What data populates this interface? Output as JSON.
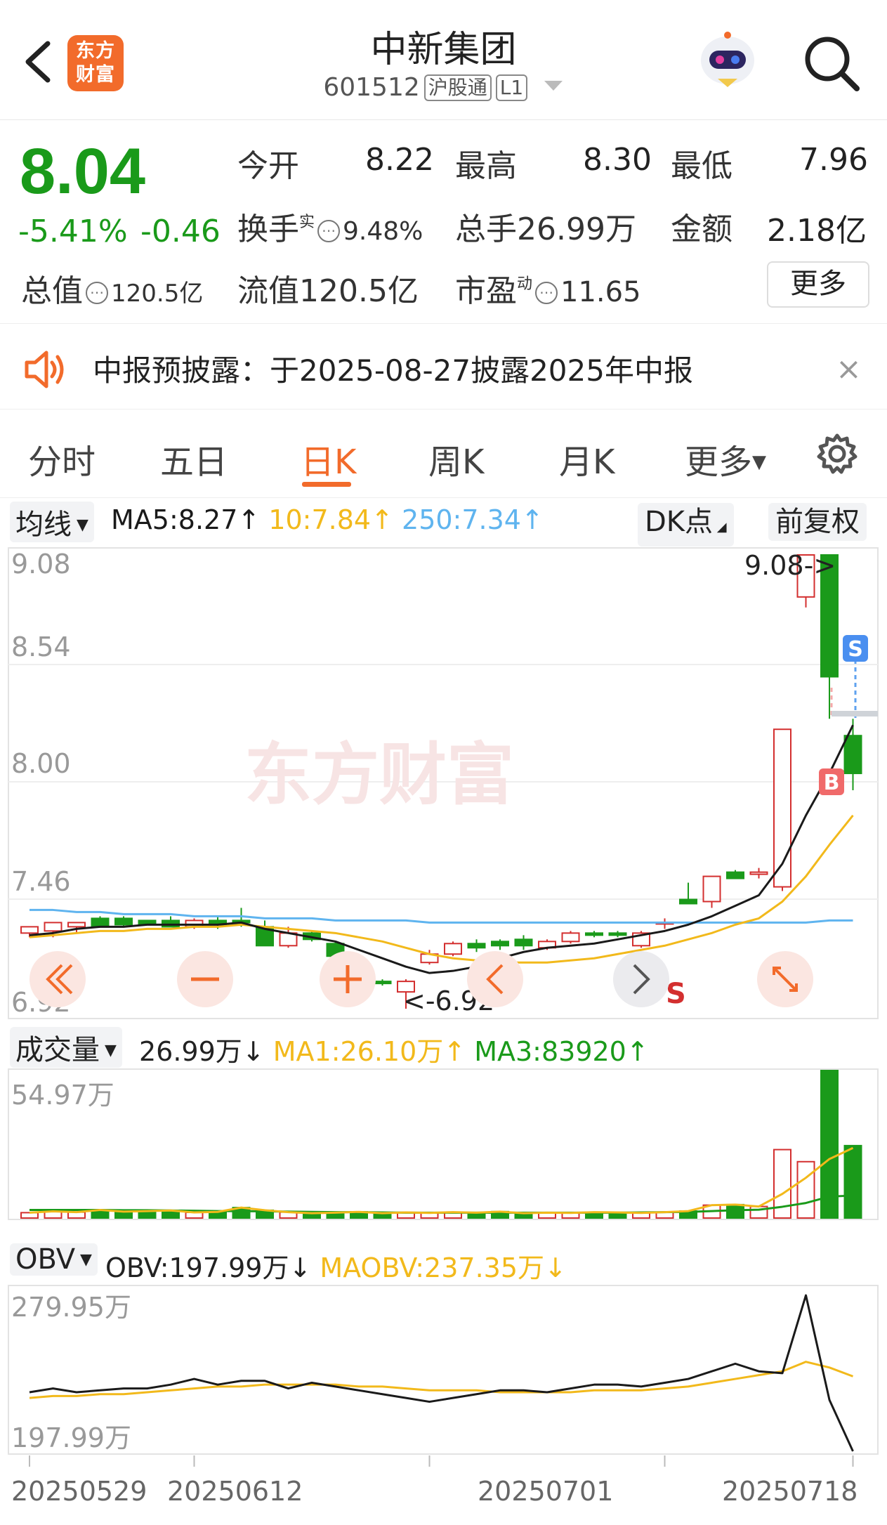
{
  "header": {
    "app_logo": "东方财富",
    "stock_name": "中新集团",
    "stock_code": "601512",
    "tag_connect": "沪股通",
    "tag_level": "L1",
    "icons": [
      "back-arrow-icon",
      "robot-assistant-icon",
      "search-icon",
      "dropdown-caret-icon"
    ]
  },
  "quote": {
    "price": "8.04",
    "change_pct": "-5.41%",
    "change_amt": "-0.46",
    "open_label": "今开",
    "open_value": "8.22",
    "high_label": "最高",
    "high_value": "8.30",
    "low_label": "最低",
    "low_value": "7.96",
    "turnover_label": "换手",
    "turnover_sup": "实",
    "turnover_value": "9.48%",
    "volume_label": "总手",
    "volume_value": "26.99万",
    "amount_label": "金额",
    "amount_value": "2.18亿",
    "mcap_label": "总值",
    "mcap_value": "120.5亿",
    "float_label": "流值",
    "float_value": "120.5亿",
    "pe_label": "市盈",
    "pe_sup": "动",
    "pe_value": "11.65",
    "more_label": "更多"
  },
  "notice": {
    "text": "中报预披露：于2025-08-27披露2025年中报",
    "close": "×"
  },
  "tabs": [
    {
      "label": "分时"
    },
    {
      "label": "五日"
    },
    {
      "label": "日K"
    },
    {
      "label": "周K"
    },
    {
      "label": "月K"
    },
    {
      "label": "更多"
    }
  ],
  "ma_bar": {
    "selector": "均线",
    "ma5": "MA5:8.27↑",
    "ma10": "10:7.84↑",
    "ma250": "250:7.34↑",
    "dk_label": "DK点",
    "adjust_label": "前复权"
  },
  "volume_bar": {
    "selector": "成交量",
    "volume": "26.99万↓",
    "ma1": "MA1:26.10万↑",
    "ma3": "MA3:83920↑"
  },
  "obv_bar": {
    "selector": "OBV",
    "obv": "OBV:197.99万↓",
    "maobv": "MAOBV:237.35万↓"
  },
  "colors": {
    "up": "#d32f2f",
    "down": "#1a9a1a",
    "ma5": "#1a1a1a",
    "ma10": "#f2b91b",
    "ma250": "#5fb4ef",
    "accent": "#f26b2b"
  },
  "chart_data": [
    {
      "type": "candlestick",
      "title": "",
      "y_ticks": [
        "9.08",
        "8.54",
        "8.00",
        "7.46",
        "6.92"
      ],
      "ylim": [
        6.92,
        9.08
      ],
      "annotations": {
        "max_label": "9.08->",
        "min_label": "<-6.92",
        "buy_marker": "B",
        "sell_marker": "S",
        "dk_sell_marker": "S"
      },
      "watermark": "东方财富",
      "candles": [
        {
          "o": 7.28,
          "h": 7.31,
          "l": 7.26,
          "c": 7.31
        },
        {
          "o": 7.29,
          "h": 7.33,
          "l": 7.26,
          "c": 7.33
        },
        {
          "o": 7.31,
          "h": 7.33,
          "l": 7.28,
          "c": 7.33
        },
        {
          "o": 7.35,
          "h": 7.36,
          "l": 7.31,
          "c": 7.31
        },
        {
          "o": 7.35,
          "h": 7.36,
          "l": 7.31,
          "c": 7.32
        },
        {
          "o": 7.34,
          "h": 7.34,
          "l": 7.32,
          "c": 7.32
        },
        {
          "o": 7.34,
          "h": 7.36,
          "l": 7.31,
          "c": 7.31
        },
        {
          "o": 7.31,
          "h": 7.35,
          "l": 7.3,
          "c": 7.34
        },
        {
          "o": 7.34,
          "h": 7.36,
          "l": 7.3,
          "c": 7.32
        },
        {
          "o": 7.34,
          "h": 7.4,
          "l": 7.31,
          "c": 7.33
        },
        {
          "o": 7.31,
          "h": 7.34,
          "l": 7.22,
          "c": 7.22
        },
        {
          "o": 7.22,
          "h": 7.31,
          "l": 7.21,
          "c": 7.28
        },
        {
          "o": 7.28,
          "h": 7.29,
          "l": 7.24,
          "c": 7.25
        },
        {
          "o": 7.23,
          "h": 7.24,
          "l": 7.17,
          "c": 7.17
        },
        {
          "o": 7.13,
          "h": 7.15,
          "l": 7.06,
          "c": 7.08
        },
        {
          "o": 7.05,
          "h": 7.06,
          "l": 7.03,
          "c": 7.04
        },
        {
          "o": 7.0,
          "h": 7.06,
          "l": 6.92,
          "c": 7.05
        },
        {
          "o": 7.14,
          "h": 7.2,
          "l": 7.13,
          "c": 7.18
        },
        {
          "o": 7.18,
          "h": 7.24,
          "l": 7.17,
          "c": 7.23
        },
        {
          "o": 7.23,
          "h": 7.25,
          "l": 7.19,
          "c": 7.21
        },
        {
          "o": 7.24,
          "h": 7.25,
          "l": 7.2,
          "c": 7.22
        },
        {
          "o": 7.25,
          "h": 7.27,
          "l": 7.2,
          "c": 7.22
        },
        {
          "o": 7.21,
          "h": 7.25,
          "l": 7.2,
          "c": 7.24
        },
        {
          "o": 7.24,
          "h": 7.29,
          "l": 7.23,
          "c": 7.28
        },
        {
          "o": 7.28,
          "h": 7.29,
          "l": 7.26,
          "c": 7.27
        },
        {
          "o": 7.28,
          "h": 7.29,
          "l": 7.26,
          "c": 7.27
        },
        {
          "o": 7.22,
          "h": 7.29,
          "l": 7.21,
          "c": 7.28
        },
        {
          "o": 7.33,
          "h": 7.35,
          "l": 7.3,
          "c": 7.33
        },
        {
          "o": 7.44,
          "h": 7.52,
          "l": 7.42,
          "c": 7.42
        },
        {
          "o": 7.43,
          "h": 7.55,
          "l": 7.4,
          "c": 7.55
        },
        {
          "o": 7.57,
          "h": 7.58,
          "l": 7.54,
          "c": 7.54
        },
        {
          "o": 7.56,
          "h": 7.59,
          "l": 7.54,
          "c": 7.57
        },
        {
          "o": 7.5,
          "h": 8.25,
          "l": 7.48,
          "c": 8.25
        },
        {
          "o": 8.88,
          "h": 9.08,
          "l": 8.83,
          "c": 9.08
        },
        {
          "o": 9.08,
          "h": 9.08,
          "l": 8.3,
          "c": 8.5
        },
        {
          "o": 8.22,
          "h": 8.3,
          "l": 7.96,
          "c": 8.04
        }
      ],
      "ma5": [
        7.27,
        7.28,
        7.3,
        7.31,
        7.31,
        7.32,
        7.32,
        7.32,
        7.32,
        7.33,
        7.3,
        7.28,
        7.26,
        7.24,
        7.2,
        7.16,
        7.12,
        7.09,
        7.1,
        7.12,
        7.16,
        7.19,
        7.21,
        7.22,
        7.23,
        7.25,
        7.27,
        7.29,
        7.32,
        7.36,
        7.41,
        7.46,
        7.61,
        7.84,
        8.04,
        8.27
      ],
      "ma10": [
        7.26,
        7.27,
        7.28,
        7.29,
        7.29,
        7.3,
        7.3,
        7.31,
        7.31,
        7.32,
        7.31,
        7.3,
        7.29,
        7.28,
        7.26,
        7.24,
        7.21,
        7.18,
        7.16,
        7.15,
        7.14,
        7.14,
        7.14,
        7.15,
        7.16,
        7.18,
        7.2,
        7.22,
        7.25,
        7.28,
        7.32,
        7.35,
        7.43,
        7.55,
        7.7,
        7.84
      ],
      "ma250": [
        7.39,
        7.39,
        7.38,
        7.38,
        7.37,
        7.37,
        7.37,
        7.36,
        7.36,
        7.36,
        7.35,
        7.35,
        7.35,
        7.34,
        7.34,
        7.34,
        7.34,
        7.33,
        7.33,
        7.33,
        7.33,
        7.33,
        7.33,
        7.33,
        7.33,
        7.33,
        7.33,
        7.33,
        7.33,
        7.33,
        7.33,
        7.33,
        7.33,
        7.33,
        7.34,
        7.34
      ]
    },
    {
      "type": "bar",
      "title": "成交量",
      "y_ticks": [
        "54.97万"
      ],
      "ylim": [
        0,
        54.97
      ],
      "unit": "万",
      "values": [
        2.0,
        2.5,
        2.2,
        3.0,
        2.4,
        2.6,
        2.8,
        2.1,
        2.3,
        3.9,
        2.9,
        2.2,
        1.8,
        2.0,
        2.3,
        1.8,
        2.1,
        1.9,
        2.2,
        2.0,
        2.4,
        1.8,
        2.0,
        1.9,
        2.2,
        2.1,
        1.9,
        2.2,
        2.6,
        4.8,
        5.0,
        4.3,
        25.5,
        21.0,
        54.97,
        26.99
      ],
      "ma1": [
        2.0,
        2.5,
        2.2,
        3.0,
        2.4,
        2.6,
        2.8,
        2.1,
        2.3,
        3.9,
        2.9,
        2.2,
        1.8,
        2.0,
        2.3,
        1.8,
        2.1,
        1.9,
        2.2,
        2.0,
        2.4,
        1.8,
        2.0,
        1.9,
        2.2,
        2.1,
        1.9,
        2.2,
        2.6,
        4.8,
        5.0,
        4.3,
        9.0,
        15.0,
        22.0,
        26.1
      ],
      "ma3": [
        3.0,
        3.0,
        3.0,
        3.0,
        2.9,
        2.9,
        2.8,
        2.7,
        2.6,
        2.6,
        2.5,
        2.4,
        2.3,
        2.2,
        2.2,
        2.1,
        2.0,
        2.0,
        2.0,
        2.0,
        2.0,
        2.0,
        2.0,
        2.0,
        2.0,
        2.0,
        2.1,
        2.2,
        2.3,
        2.6,
        2.9,
        3.1,
        4.2,
        5.6,
        8.0,
        8.39
      ]
    },
    {
      "type": "line",
      "title": "OBV",
      "y_ticks": [
        "279.95万",
        "197.99万"
      ],
      "ylim": [
        197.99,
        279.95
      ],
      "unit": "万",
      "x_ticks": [
        "20250529",
        "20250612",
        "20250701",
        "20250718"
      ],
      "obv": [
        229,
        231,
        229,
        230,
        231,
        231,
        233,
        236,
        233,
        235,
        235,
        231,
        234,
        232,
        230,
        228,
        226,
        224,
        226,
        228,
        230,
        230,
        229,
        231,
        233,
        233,
        232,
        234,
        236,
        240,
        244,
        240,
        239,
        279.95,
        225,
        197.99
      ],
      "maobv": [
        226,
        227,
        227,
        228,
        228,
        229,
        230,
        231,
        232,
        232,
        233,
        233,
        233,
        233,
        232,
        232,
        231,
        230,
        230,
        230,
        229,
        229,
        229,
        229,
        230,
        230,
        230,
        231,
        232,
        234,
        236,
        238,
        240,
        245,
        242,
        237.35
      ]
    }
  ]
}
